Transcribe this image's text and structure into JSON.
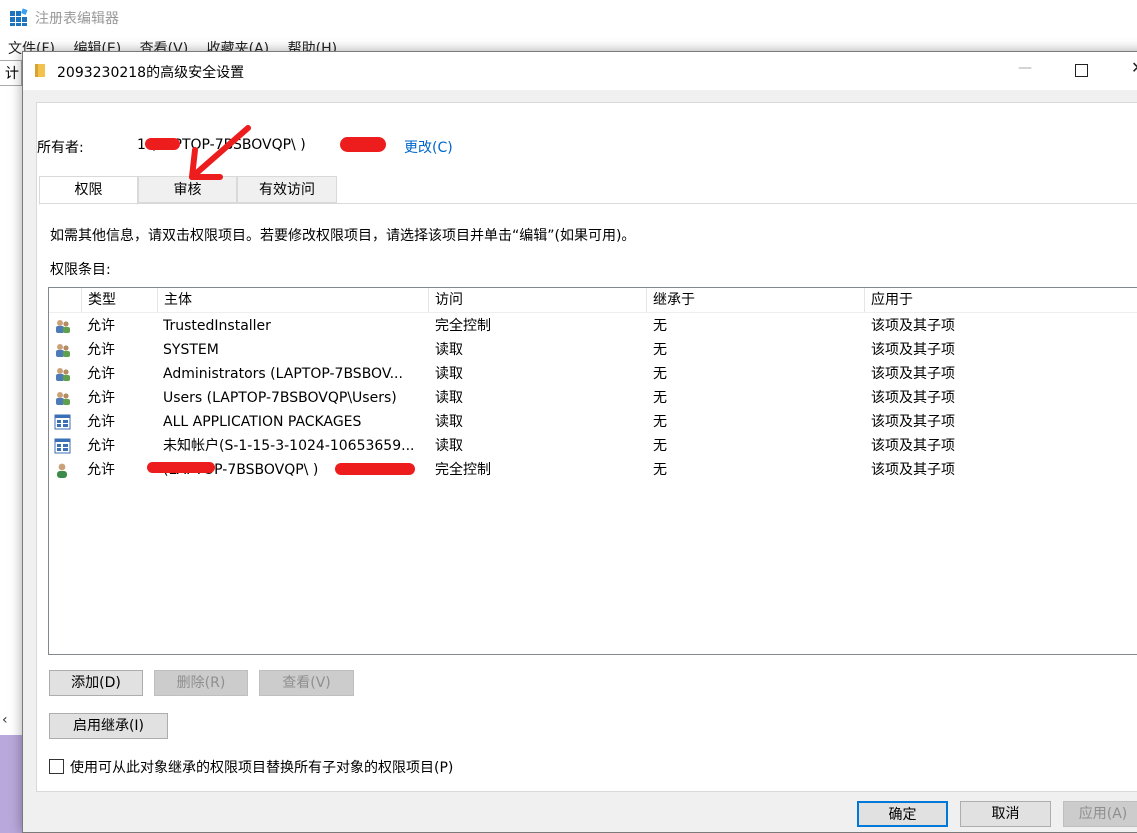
{
  "regedit": {
    "title": "注册表编辑器",
    "menu": [
      "文件(F)",
      "编辑(E)",
      "查看(V)",
      "收藏夹(A)",
      "帮助(H)"
    ],
    "address_fragment": "计"
  },
  "dialog": {
    "title": "2093230218的高级安全设置",
    "owner_label": "所有者:",
    "owner_value": "1 (LAPTOP-7BSBOVQP\\ )",
    "owner_change": "更改(C)",
    "tabs": [
      "权限",
      "审核",
      "有效访问"
    ],
    "info_text": "如需其他信息，请双击权限项目。若要修改权限项目，请选择该项目并单击“编辑”(如果可用)。",
    "permissions_label": "权限条目:",
    "columns": [
      "类型",
      "主体",
      "访问",
      "继承于",
      "应用于"
    ],
    "rows": [
      {
        "icon": "users-group-icon",
        "type": "允许",
        "principal": "TrustedInstaller",
        "access": "完全控制",
        "inherited": "无",
        "applies": "该项及其子项"
      },
      {
        "icon": "users-group-icon",
        "type": "允许",
        "principal": "SYSTEM",
        "access": "读取",
        "inherited": "无",
        "applies": "该项及其子项"
      },
      {
        "icon": "users-group-icon",
        "type": "允许",
        "principal": "Administrators (LAPTOP-7BSBOV...",
        "access": "读取",
        "inherited": "无",
        "applies": "该项及其子项"
      },
      {
        "icon": "users-group-icon",
        "type": "允许",
        "principal": "Users (LAPTOP-7BSBOVQP\\Users)",
        "access": "读取",
        "inherited": "无",
        "applies": "该项及其子项"
      },
      {
        "icon": "app-package-icon",
        "type": "允许",
        "principal": "ALL APPLICATION PACKAGES",
        "access": "读取",
        "inherited": "无",
        "applies": "该项及其子项"
      },
      {
        "icon": "app-package-icon",
        "type": "允许",
        "principal": "未知帐户(S-1-15-3-1024-10653659...",
        "access": "读取",
        "inherited": "无",
        "applies": "该项及其子项"
      },
      {
        "icon": "user-icon",
        "type": "允许",
        "principal": "(LAPTOP-7BSBOVQP\\ )",
        "access": "完全控制",
        "inherited": "无",
        "applies": "该项及其子项"
      }
    ],
    "buttons": {
      "add": "添加(D)",
      "remove": "删除(R)",
      "view": "查看(V)",
      "enable_inheritance": "启用继承(I)",
      "ok": "确定",
      "cancel": "取消",
      "apply": "应用(A)"
    },
    "replace_checkbox": "使用可从此对象继承的权限项目替换所有子对象的权限项目(P)"
  },
  "colors": {
    "link": "#0066cc",
    "annotation": "#ee1d1d",
    "desktop": "#b9a8dc"
  }
}
